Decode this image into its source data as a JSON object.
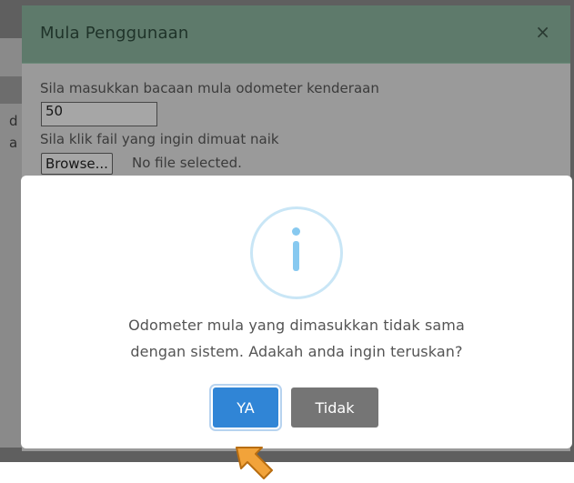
{
  "background_page": {
    "edge_fragments": [
      "d",
      "a"
    ]
  },
  "modal": {
    "title": "Mula Penggunaan",
    "close_glyph": "×",
    "odometer_label": "Sila masukkan bacaan mula odometer kenderaan",
    "odometer_value": "50",
    "file_label": "Sila klik fail yang ingin dimuat naik",
    "browse_label": "Browse...",
    "file_status": "No file selected."
  },
  "dialog": {
    "icon": "info-icon",
    "message_line1": "Odometer mula yang dimasukkan tidak sama",
    "message_line2": "dengan sistem. Adakah anda ingin teruskan?",
    "confirm_label": "YA",
    "cancel_label": "Tidak"
  },
  "colors": {
    "confirm_button": "#3085d6",
    "cancel_button": "#757575",
    "modal_header": "#5e7a6b",
    "info_icon": "#87c9f0",
    "pointer_arrow": "#f2a33a"
  }
}
